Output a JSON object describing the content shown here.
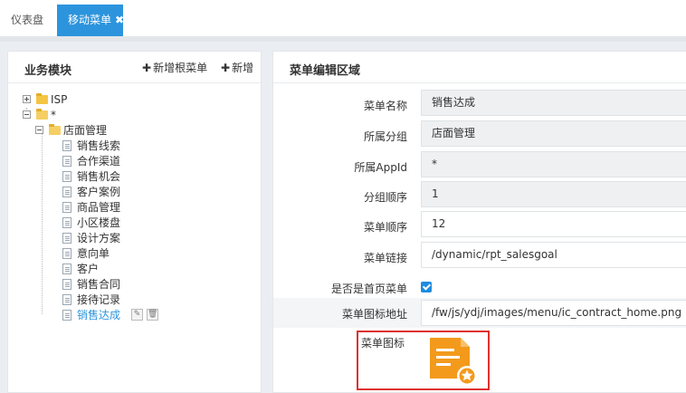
{
  "tabs": [
    {
      "label": "仪表盘"
    },
    {
      "label": "移动菜单",
      "close": "✖"
    }
  ],
  "left_panel": {
    "title": "业务模块",
    "add_root_label": "新增根菜单",
    "add_label": "新增",
    "plus": "✚",
    "tree": {
      "root_isp": "ISP",
      "root_star": "*",
      "store_group": "店面管理",
      "items": [
        "销售线索",
        "合作渠道",
        "销售机会",
        "客户案例",
        "商品管理",
        "小区楼盘",
        "设计方案",
        "意向单",
        "客户",
        "销售合同",
        "接待记录",
        "销售达成"
      ]
    }
  },
  "right_panel": {
    "title": "菜单编辑区域",
    "fields": {
      "menu_name": {
        "label": "菜单名称",
        "value": "销售达成"
      },
      "group": {
        "label": "所属分组",
        "value": "店面管理"
      },
      "app_id": {
        "label": "所属AppId",
        "value": "*"
      },
      "group_order": {
        "label": "分组顺序",
        "value": "1"
      },
      "menu_order": {
        "label": "菜单顺序",
        "value": "12"
      },
      "menu_link": {
        "label": "菜单链接",
        "value": "/dynamic/rpt_salesgoal"
      },
      "is_home": {
        "label": "是否是首页菜单",
        "checked": true
      },
      "icon_url": {
        "label": "菜单图标地址",
        "value": "/fw/js/ydj/images/menu/ic_contract_home.png"
      },
      "icon": {
        "label": "菜单图标"
      }
    }
  },
  "colors": {
    "accent": "#2c94dd",
    "icon_orange": "#f39a1c",
    "highlight_border": "#e03030"
  }
}
